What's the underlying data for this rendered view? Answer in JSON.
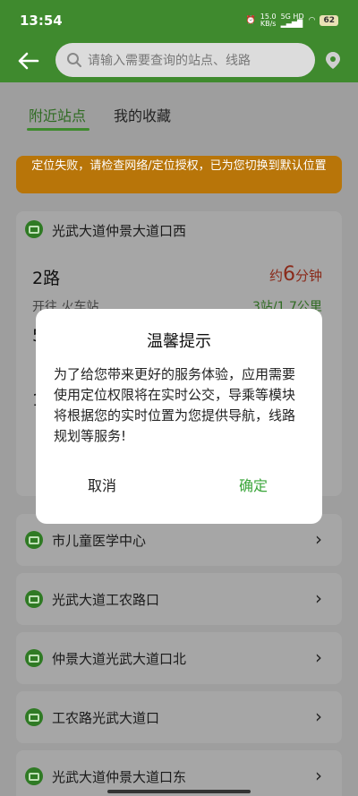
{
  "status": {
    "time": "13:54",
    "net_speed_value": "15.0",
    "net_speed_unit": "KB/s",
    "network": "5G HD",
    "battery": "62"
  },
  "search": {
    "placeholder": "请输入需要查询的站点、线路"
  },
  "tabs": [
    {
      "label": "附近站点"
    },
    {
      "label": "我的收藏"
    }
  ],
  "banner": {
    "text": "定位失败，请检查网络/定位授权，已为您切换到默认位置"
  },
  "nearby_station": {
    "name": "光武大道仲景大道口西",
    "routes": [
      {
        "name": "2路",
        "direction": "开往  火车站",
        "eta_prefix": "约",
        "eta_value": "6",
        "eta_unit": "分钟",
        "distance": "3站/1.7公里"
      }
    ],
    "partial_routes": [
      "5",
      "1"
    ]
  },
  "stations": [
    {
      "name": "市儿童医学中心"
    },
    {
      "name": "光武大道工农路口"
    },
    {
      "name": "仲景大道光武大道口北"
    },
    {
      "name": "工农路光武大道口"
    },
    {
      "name": "光武大道仲景大道口东"
    }
  ],
  "dialog": {
    "title": "温馨提示",
    "body": "为了给您带来更好的服务体验，应用需要使用定位权限将在实时公交，导乘等模块将根据您的实时位置为您提供导航，线路规划等服务!",
    "cancel": "取消",
    "confirm": "确定"
  },
  "colors": {
    "brand_green": "#3f8a2e",
    "warning_orange": "#e8960f",
    "eta_red": "#d2452b",
    "confirm_green": "#3aa53a"
  }
}
